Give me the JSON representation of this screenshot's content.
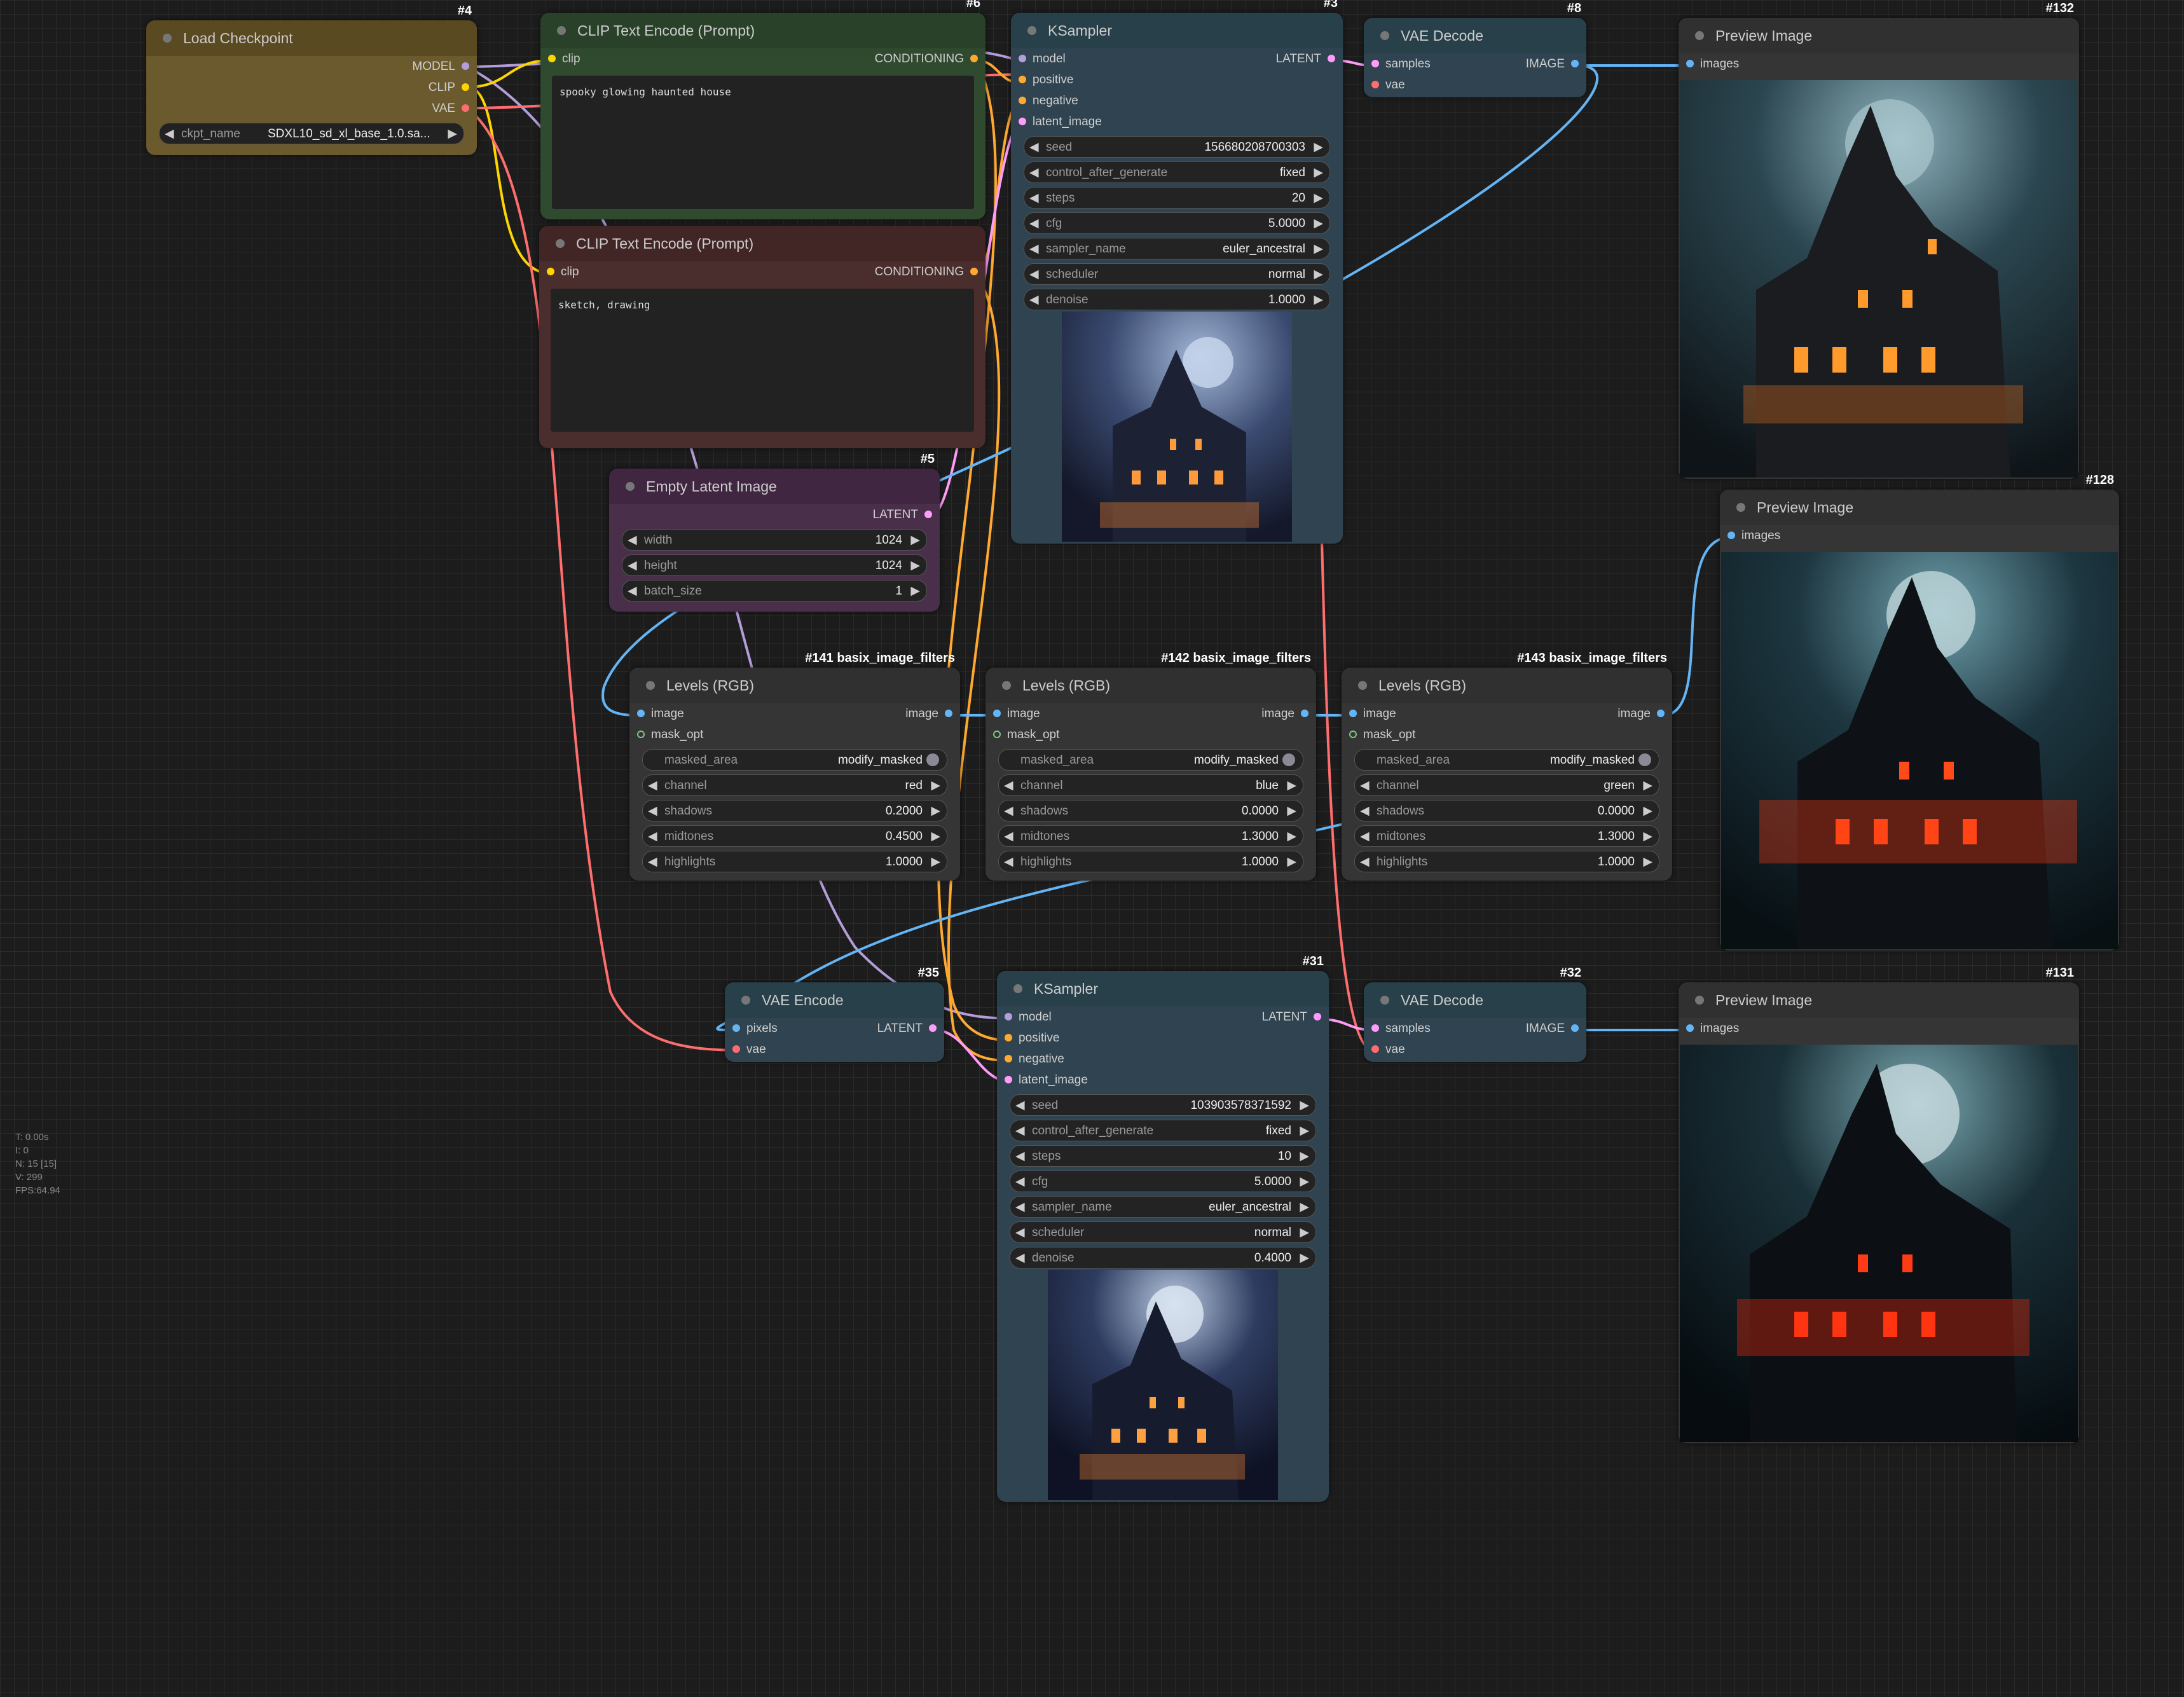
{
  "stats": [
    "T: 0.00s",
    "I: 0",
    "N: 15 [15]",
    "V: 299",
    "FPS:64.94"
  ],
  "nodes": {
    "load_checkpoint": {
      "id": "#4",
      "title": "Load Checkpoint",
      "outputs": [
        "MODEL",
        "CLIP",
        "VAE"
      ],
      "widget_name": "ckpt_name",
      "widget_value": "SDXL10_sd_xl_base_1.0.sa..."
    },
    "clip_pos": {
      "id": "#6",
      "title": "CLIP Text Encode (Prompt)",
      "input": "clip",
      "output": "CONDITIONING",
      "text": "spooky glowing haunted house"
    },
    "clip_neg": {
      "id": "#7",
      "title": "CLIP Text Encode (Prompt)",
      "input": "clip",
      "output": "CONDITIONING",
      "text": "sketch, drawing"
    },
    "ksampler1": {
      "id": "#3",
      "title": "KSampler",
      "inputs": [
        "model",
        "positive",
        "negative",
        "latent_image"
      ],
      "output": "LATENT",
      "widgets": [
        {
          "name": "seed",
          "value": "156680208700303"
        },
        {
          "name": "control_after_generate",
          "value": "fixed"
        },
        {
          "name": "steps",
          "value": "20"
        },
        {
          "name": "cfg",
          "value": "5.0000"
        },
        {
          "name": "sampler_name",
          "value": "euler_ancestral"
        },
        {
          "name": "scheduler",
          "value": "normal"
        },
        {
          "name": "denoise",
          "value": "1.0000"
        }
      ]
    },
    "vae_decode1": {
      "id": "#8",
      "title": "VAE Decode",
      "inputs": [
        "samples",
        "vae"
      ],
      "output": "IMAGE"
    },
    "preview132": {
      "id": "#132",
      "title": "Preview Image",
      "input": "images"
    },
    "empty_latent": {
      "id": "#5",
      "title": "Empty Latent Image",
      "output": "LATENT",
      "widgets": [
        {
          "name": "width",
          "value": "1024"
        },
        {
          "name": "height",
          "value": "1024"
        },
        {
          "name": "batch_size",
          "value": "1"
        }
      ]
    },
    "levels141": {
      "id": "#141 basix_image_filters",
      "title": "Levels (RGB)",
      "inputs": [
        "image",
        "mask_opt"
      ],
      "output": "image",
      "toggle": {
        "name": "masked_area",
        "value": "modify_masked"
      },
      "widgets": [
        {
          "name": "channel",
          "value": "red"
        },
        {
          "name": "shadows",
          "value": "0.2000"
        },
        {
          "name": "midtones",
          "value": "0.4500"
        },
        {
          "name": "highlights",
          "value": "1.0000"
        }
      ]
    },
    "levels142": {
      "id": "#142 basix_image_filters",
      "title": "Levels (RGB)",
      "inputs": [
        "image",
        "mask_opt"
      ],
      "output": "image",
      "toggle": {
        "name": "masked_area",
        "value": "modify_masked"
      },
      "widgets": [
        {
          "name": "channel",
          "value": "blue"
        },
        {
          "name": "shadows",
          "value": "0.0000"
        },
        {
          "name": "midtones",
          "value": "1.3000"
        },
        {
          "name": "highlights",
          "value": "1.0000"
        }
      ]
    },
    "levels143": {
      "id": "#143 basix_image_filters",
      "title": "Levels (RGB)",
      "inputs": [
        "image",
        "mask_opt"
      ],
      "output": "image",
      "toggle": {
        "name": "masked_area",
        "value": "modify_masked"
      },
      "widgets": [
        {
          "name": "channel",
          "value": "green"
        },
        {
          "name": "shadows",
          "value": "0.0000"
        },
        {
          "name": "midtones",
          "value": "1.3000"
        },
        {
          "name": "highlights",
          "value": "1.0000"
        }
      ]
    },
    "preview128": {
      "id": "#128",
      "title": "Preview Image",
      "input": "images"
    },
    "vae_encode": {
      "id": "#35",
      "title": "VAE Encode",
      "inputs": [
        "pixels",
        "vae"
      ],
      "output": "LATENT"
    },
    "ksampler2": {
      "id": "#31",
      "title": "KSampler",
      "inputs": [
        "model",
        "positive",
        "negative",
        "latent_image"
      ],
      "output": "LATENT",
      "widgets": [
        {
          "name": "seed",
          "value": "103903578371592"
        },
        {
          "name": "control_after_generate",
          "value": "fixed"
        },
        {
          "name": "steps",
          "value": "10"
        },
        {
          "name": "cfg",
          "value": "5.0000"
        },
        {
          "name": "sampler_name",
          "value": "euler_ancestral"
        },
        {
          "name": "scheduler",
          "value": "normal"
        },
        {
          "name": "denoise",
          "value": "0.4000"
        }
      ]
    },
    "vae_decode2": {
      "id": "#32",
      "title": "VAE Decode",
      "inputs": [
        "samples",
        "vae"
      ],
      "output": "IMAGE"
    },
    "preview131": {
      "id": "#131",
      "title": "Preview Image",
      "input": "images"
    }
  },
  "colors": {
    "model": "#b39ddb",
    "clip": "#ffd500",
    "vae": "#ff6e6e",
    "conditioning": "#ffa931",
    "latent": "#ff9cf9",
    "image": "#64b5f6",
    "mask": "#81c784"
  }
}
